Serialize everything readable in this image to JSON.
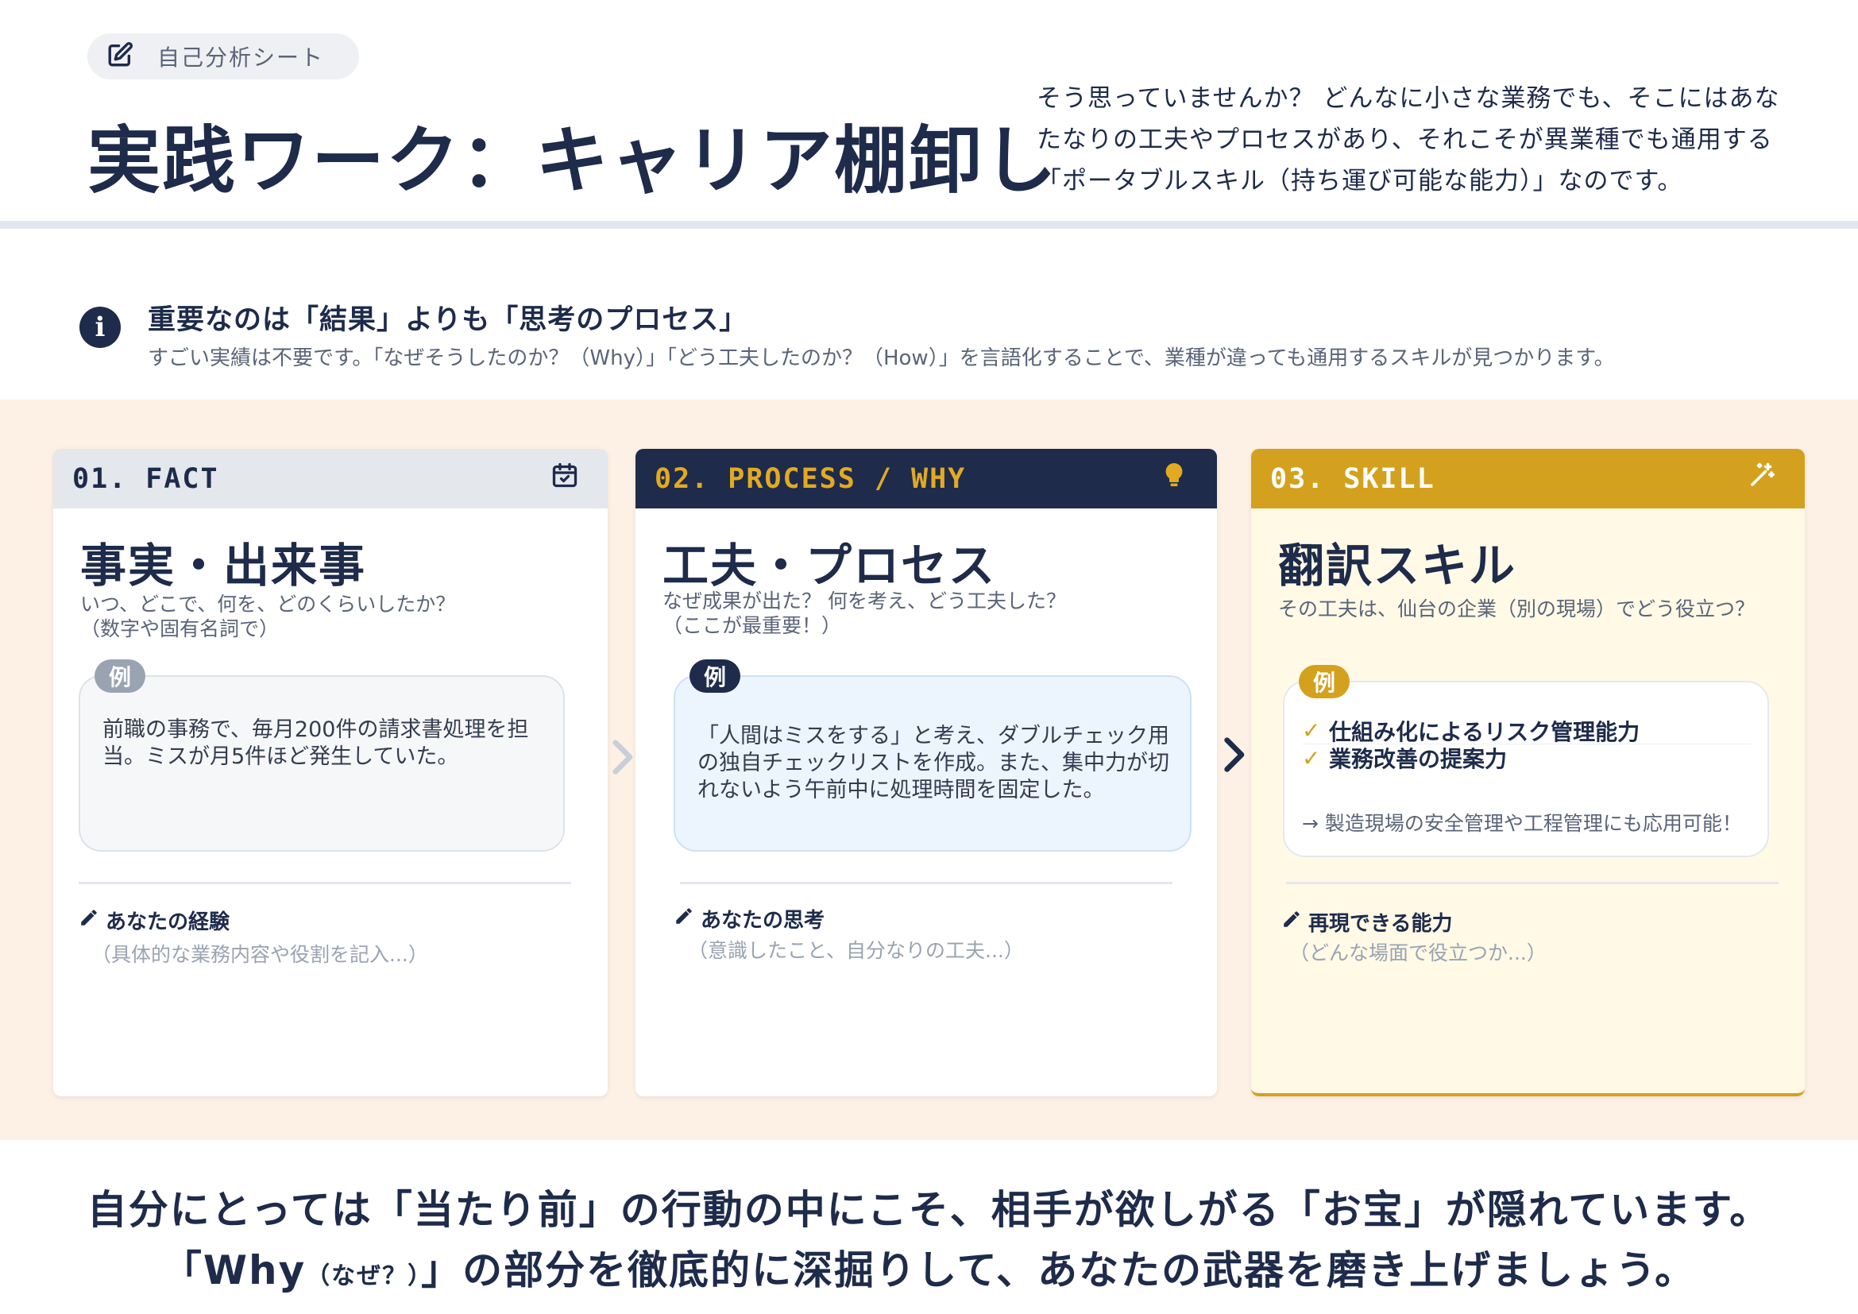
{
  "header": {
    "pill_icon": "edit-icon",
    "pill_label": "自己分析シート",
    "title": "実践ワーク：キャリア棚卸し",
    "intro": "そう思っていませんか？ どんなに小さな業務でも、そこにはあなたなりの工夫やプロセスがあり、それこそが異業種でも通用する「ポータブルスキル（持ち運び可能な能力）」なのです。"
  },
  "notice": {
    "icon": "info-icon",
    "title": "重要なのは「結果」よりも「思考のプロセス」",
    "body": "すごい実績は不要です。「なぜそうしたのか？（Why）」「どう工夫したのか？（How）」を言語化することで、業種が違っても通用するスキルが見つかります。"
  },
  "cards": [
    {
      "header": "01. FACT",
      "icon": "calendar-check-icon",
      "title": "事実・出来事",
      "subtitle_1": "いつ、どこで、何を、どのくらいしたか？",
      "subtitle_2": "（数字や固有名詞で）",
      "example_tag": "例",
      "example_text": "前職の事務で、毎月200件の請求書処理を担当。ミスが月5件ほど発生していた。",
      "write_label": "あなたの経験",
      "write_hint": "（具体的な業務内容や役割を記入...）"
    },
    {
      "header": "02. PROCESS / WHY",
      "icon": "lightbulb-icon",
      "title": "工夫・プロセス",
      "subtitle_1": "なぜ成果が出た？ 何を考え、どう工夫した？",
      "subtitle_2": "（ここが最重要！）",
      "example_tag": "例",
      "example_text": "「人間はミスをする」と考え、ダブルチェック用の独自チェックリストを作成。また、集中力が切れないよう午前中に処理時間を固定した。",
      "write_label": "あなたの思考",
      "write_hint": "（意識したこと、自分なりの工夫...）"
    },
    {
      "header": "03. SKILL",
      "icon": "magic-wand-icon",
      "title": "翻訳スキル",
      "subtitle_1": "その工夫は、仙台の企業（別の現場）でどう役立つ？",
      "example_tag": "例",
      "skills": [
        "仕組み化によるリスク管理能力",
        "業務改善の提案力"
      ],
      "skill_note": "→ 製造現場の安全管理や工程管理にも応用可能！",
      "write_label": "再現できる能力",
      "write_hint": "（どんな場面で役立つか...）"
    }
  ],
  "footer": {
    "line1": "自分にとっては「当たり前」の行動の中にこそ、相手が欲しがる「お宝」が隠れています。",
    "line2_a": "「Why",
    "line2_small": "（なぜ？）",
    "line2_b": "」の部分を徹底的に深掘りして、あなたの武器を磨き上げましょう。"
  },
  "colors": {
    "navy": "#1e2b4a",
    "gold": "#d4a11e",
    "peach_bg": "#fdf0e4",
    "cream": "#fff9e6"
  }
}
